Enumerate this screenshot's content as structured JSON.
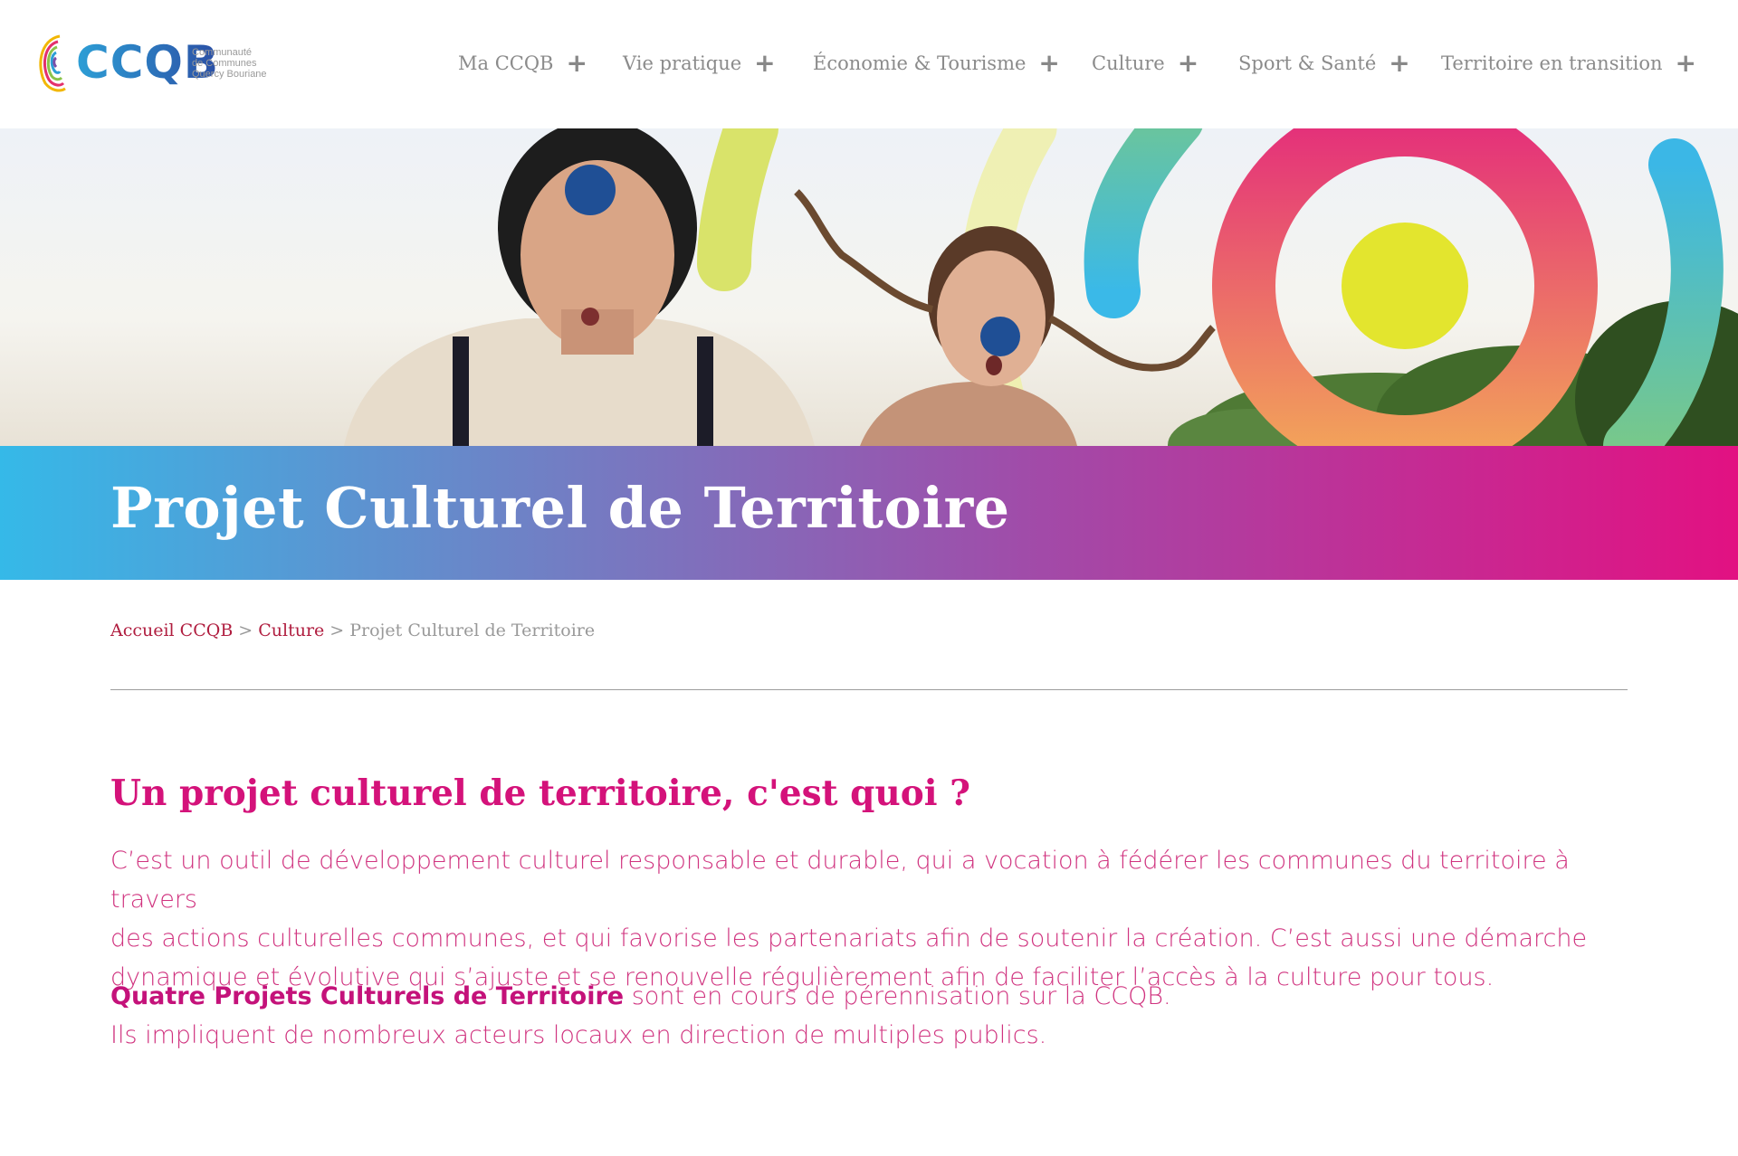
{
  "logo": {
    "word": "CCQB",
    "sub_lines": [
      "Communauté",
      "de Communes",
      "Quercy Bouriane"
    ]
  },
  "nav": {
    "items": [
      {
        "label": "Ma CCQB"
      },
      {
        "label": "Vie pratique"
      },
      {
        "label": "Économie & Tourisme"
      },
      {
        "label": "Culture"
      },
      {
        "label": "Sport & Santé"
      },
      {
        "label": "Territoire en transition"
      }
    ],
    "expand_symbol": "+"
  },
  "banner": {
    "title": "Projet Culturel de Territoire"
  },
  "breadcrumb": {
    "home": "Accueil CCQB",
    "section": "Culture",
    "current": "Projet Culturel de Territoire",
    "separator": ">"
  },
  "content": {
    "heading": "Un projet culturel de territoire, c'est quoi ?",
    "paragraph1_lines": [
      "C’est un outil de développement culturel responsable et durable, qui a vocation à fédérer les communes du territoire à travers",
      "des actions culturelles communes, et qui favorise les partenariats afin de soutenir la création. C’est aussi une démarche",
      "dynamique et évolutive qui s’ajuste et se renouvelle régulièrement afin de faciliter l’accès à la culture pour tous."
    ],
    "paragraph2_strong": "Quatre Projets Culturels de Territoire",
    "paragraph2_rest": " sont en cours de pérennisation sur la CCQB.",
    "paragraph2_line2": "Ils impliquent de nombreux acteurs locaux en direction de multiples publics."
  },
  "colors": {
    "brand_pink": "#d4127a",
    "brand_blue": "#35b9e8",
    "breadcrumb_link": "#b01d3f"
  }
}
